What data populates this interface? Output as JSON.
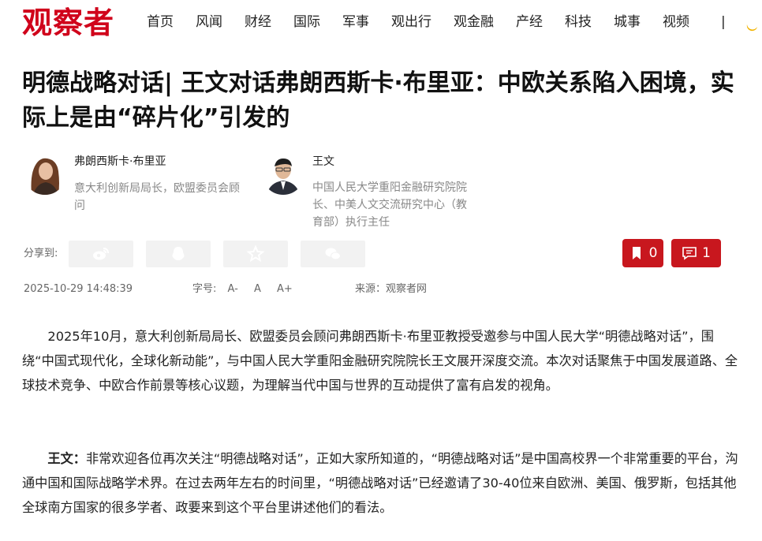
{
  "site": {
    "logo": "观察者"
  },
  "nav": {
    "items": [
      "首页",
      "风闻",
      "财经",
      "国际",
      "军事",
      "观出行",
      "观金融",
      "产经",
      "科技",
      "城事",
      "视频"
    ],
    "separator": "|"
  },
  "article": {
    "title": "明德战略对话| 王文对话弗朗西斯卡·布里亚：中欧关系陷入困境，实际上是由“碎片化”引发的",
    "authors": [
      {
        "name": "弗朗西斯卡·布里亚",
        "desc": "意大利创新局局长，欧盟委员会顾问"
      },
      {
        "name": "王文",
        "desc": "中国人民大学重阳金融研究院院长、中美人文交流研究中心（教育部）执行主任"
      }
    ],
    "share_label": "分享到:",
    "bookmark_count": "0",
    "comment_count": "1",
    "date": "2025-10-29 14:48:39",
    "font_size_label": "字号:",
    "font_small": "A-",
    "font_normal": "A",
    "font_large": "A+",
    "source": "来源：观察者网",
    "paragraphs": [
      {
        "speaker": "",
        "text": "2025年10月，意大利创新局局长、欧盟委员会顾问弗朗西斯卡·布里亚教授受邀参与中国人民大学“明德战略对话”，围绕“中国式现代化，全球化新动能”，与中国人民大学重阳金融研究院院长王文展开深度交流。本次对话聚焦于中国发展道路、全球技术竞争、中欧合作前景等核心议题，为理解当代中国与世界的互动提供了富有启发的视角。"
      },
      {
        "speaker": "王文：",
        "text": "非常欢迎各位再次关注“明德战略对话”，正如大家所知道的，“明德战略对话”是中国高校界一个非常重要的平台，沟通中国和国际战略学术界。在过去两年左右的时间里，“明德战略对话”已经邀请了30-40位来自欧洲、美国、俄罗斯，包括其他全球南方国家的很多学者、政要来到这个平台里讲述他们的看法。"
      }
    ]
  },
  "colors": {
    "brand": "#d0021b",
    "button_red": "#c8171e",
    "share_bg": "#f2f2f2"
  }
}
